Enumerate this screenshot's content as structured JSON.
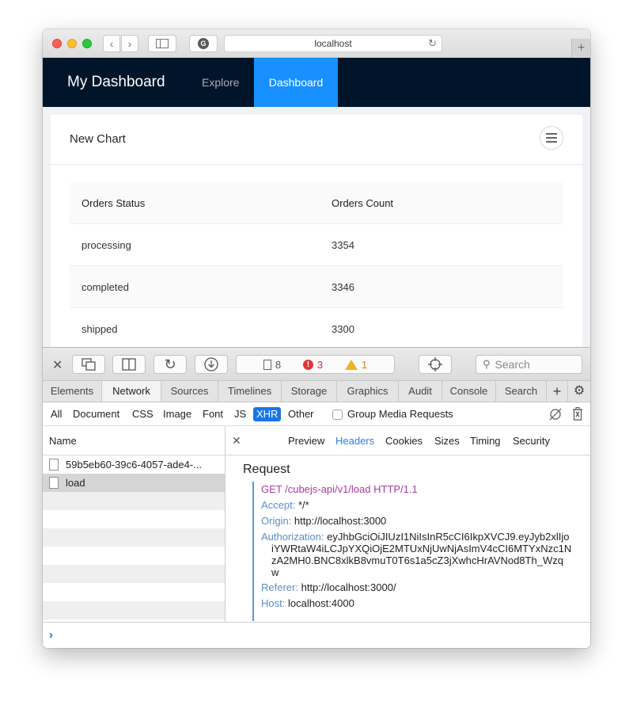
{
  "browser": {
    "url": "localhost"
  },
  "app": {
    "brand": "My Dashboard",
    "nav": [
      {
        "label": "Explore",
        "active": false
      },
      {
        "label": "Dashboard",
        "active": true
      }
    ],
    "card_title": "New Chart",
    "table": {
      "headers": [
        "Orders Status",
        "Orders Count"
      ],
      "rows": [
        [
          "processing",
          "3354"
        ],
        [
          "completed",
          "3346"
        ],
        [
          "shipped",
          "3300"
        ]
      ]
    }
  },
  "devtools": {
    "resource_count": "8",
    "error_count": "3",
    "warning_count": "1",
    "search_placeholder": "Search",
    "tabs": [
      "Elements",
      "Network",
      "Sources",
      "Timelines",
      "Storage",
      "Graphics",
      "Audit",
      "Console",
      "Search"
    ],
    "active_tab": "Network",
    "filters": [
      "All",
      "Document",
      "CSS",
      "Image",
      "Font",
      "JS",
      "XHR",
      "Other"
    ],
    "active_filter": "XHR",
    "group_media_label": "Group Media Requests",
    "name_header": "Name",
    "requests": [
      {
        "name": "59b5eb60-39c6-4057-ade4-..."
      },
      {
        "name": "load"
      }
    ],
    "detail_tabs": [
      "Preview",
      "Headers",
      "Cookies",
      "Sizes",
      "Timing",
      "Security"
    ],
    "active_detail_tab": "Headers",
    "request_title": "Request",
    "request_line": "GET /cubejs-api/v1/load HTTP/1.1",
    "headers": {
      "accept_k": "Accept:",
      "accept_v": "*/*",
      "origin_k": "Origin:",
      "origin_v": "http://localhost:3000",
      "auth_k": "Authorization:",
      "auth_v1": "eyJhbGciOiJIUzI1NiIsInR5cCI6IkpXVCJ9.eyJyb2xlIjo",
      "auth_v2": "iYWRtaW4iLCJpYXQiOjE2MTUxNjUwNjAsImV4cCI6MTYxNzc1N",
      "auth_v3": "zA2MH0.BNC8xlkB8vmuT0T6s1a5cZ3jXwhcHrAVNod8Th_Wzq",
      "auth_v4": "w",
      "referer_k": "Referer:",
      "referer_v": "http://localhost:3000/",
      "host_k": "Host:",
      "host_v": "localhost:4000"
    }
  }
}
